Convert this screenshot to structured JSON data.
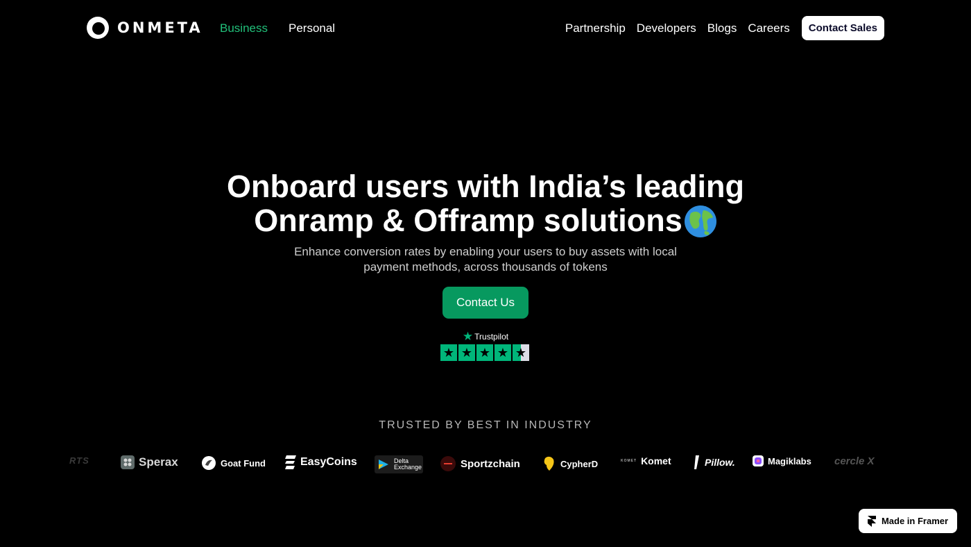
{
  "nav": {
    "logo_text": "ONMETA",
    "switch": [
      "Business",
      "Personal"
    ],
    "links": [
      "Partnership",
      "Developers",
      "Blogs",
      "Careers"
    ],
    "cta": "Contact Sales"
  },
  "hero": {
    "title_line1": "Onboard users with India’s leading",
    "title_line2": "Onramp & Offramp solutions",
    "subtitle_line1": "Enhance conversion rates by enabling your users to buy assets with local",
    "subtitle_line2": "payment methods, across thousands of tokens",
    "cta": "Contact Us"
  },
  "trustpilot": {
    "brand": "Trustpilot",
    "rating_stars": 4.5,
    "max_stars": 5
  },
  "trusted": {
    "heading": "TRUSTED BY BEST IN INDUSTRY",
    "partners": [
      "RTS",
      "Sperax",
      "Goat Fund",
      "EasyCoins",
      "Delta Exchange",
      "Sportzchain",
      "CypherD",
      "Komet",
      "Pillow.",
      "Magiklabs",
      "cercle X"
    ]
  },
  "badge": {
    "label": "Made in Framer"
  },
  "colors": {
    "background": "#000000",
    "accent_green": "#21c07a",
    "button_green": "#07995f",
    "trustpilot_green": "#00b67a"
  }
}
